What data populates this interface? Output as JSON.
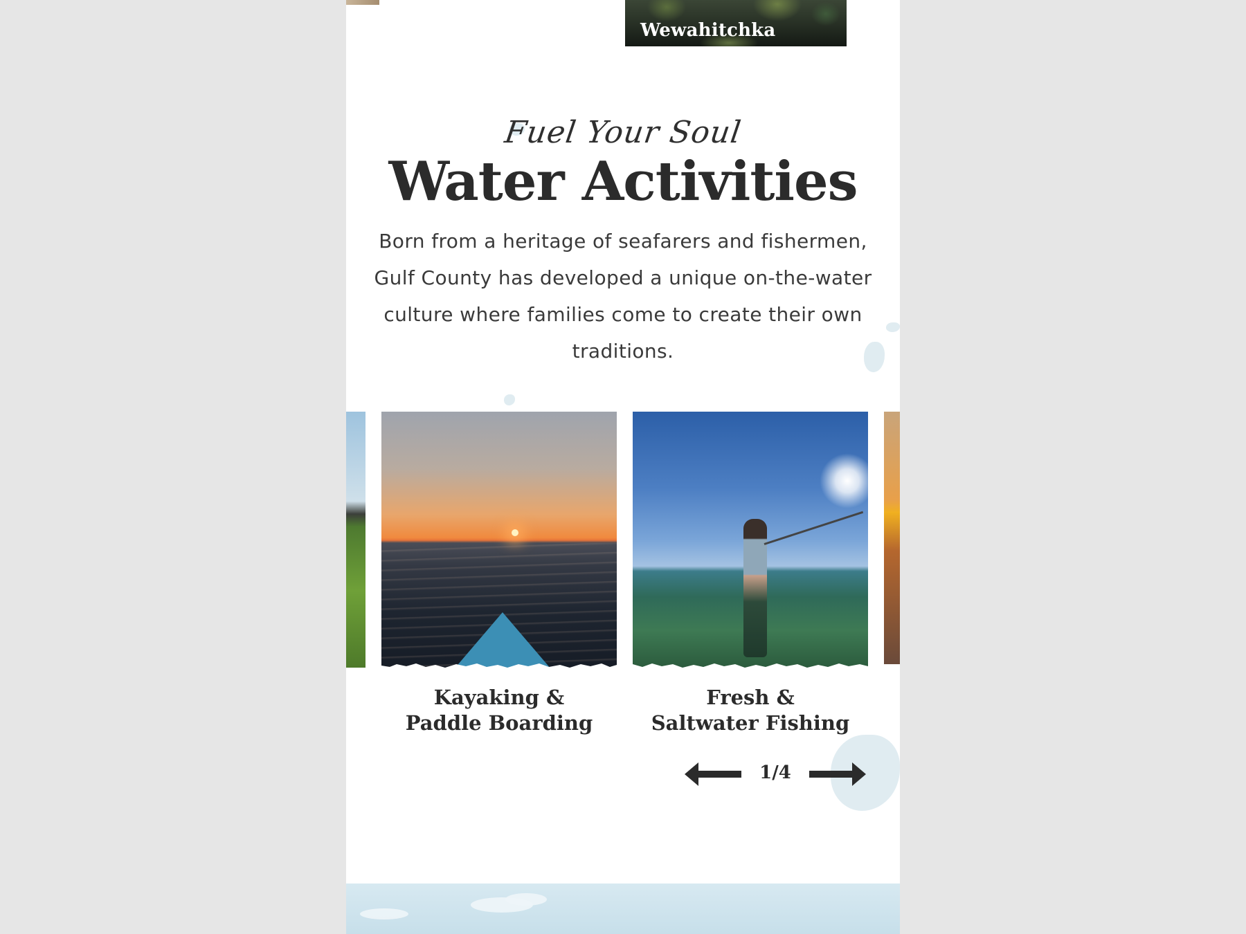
{
  "top": {
    "location_label": "Wewahitchka"
  },
  "section": {
    "script_title": "Fuel Your Soul",
    "heading": "Water Activities",
    "description": "Born from a heritage of seafarers and fishermen, Gulf County has developed a unique on-the-water culture where families come to create their own traditions."
  },
  "carousel": {
    "cards": [
      {
        "caption_line1": "Kayaking &",
        "caption_line2": "Paddle Boarding",
        "image": "sunset-kayak-photo"
      },
      {
        "caption_line1": "Fresh &",
        "caption_line2": "Saltwater Fishing",
        "image": "woman-fishing-photo"
      }
    ],
    "pager": {
      "current": 1,
      "total": 4,
      "label": "1/4"
    }
  },
  "colors": {
    "text_dark": "#2b2b2b",
    "accent_blob": "#dbe9ee",
    "background": "#ffffff",
    "outer_background": "#e6e6e6"
  }
}
